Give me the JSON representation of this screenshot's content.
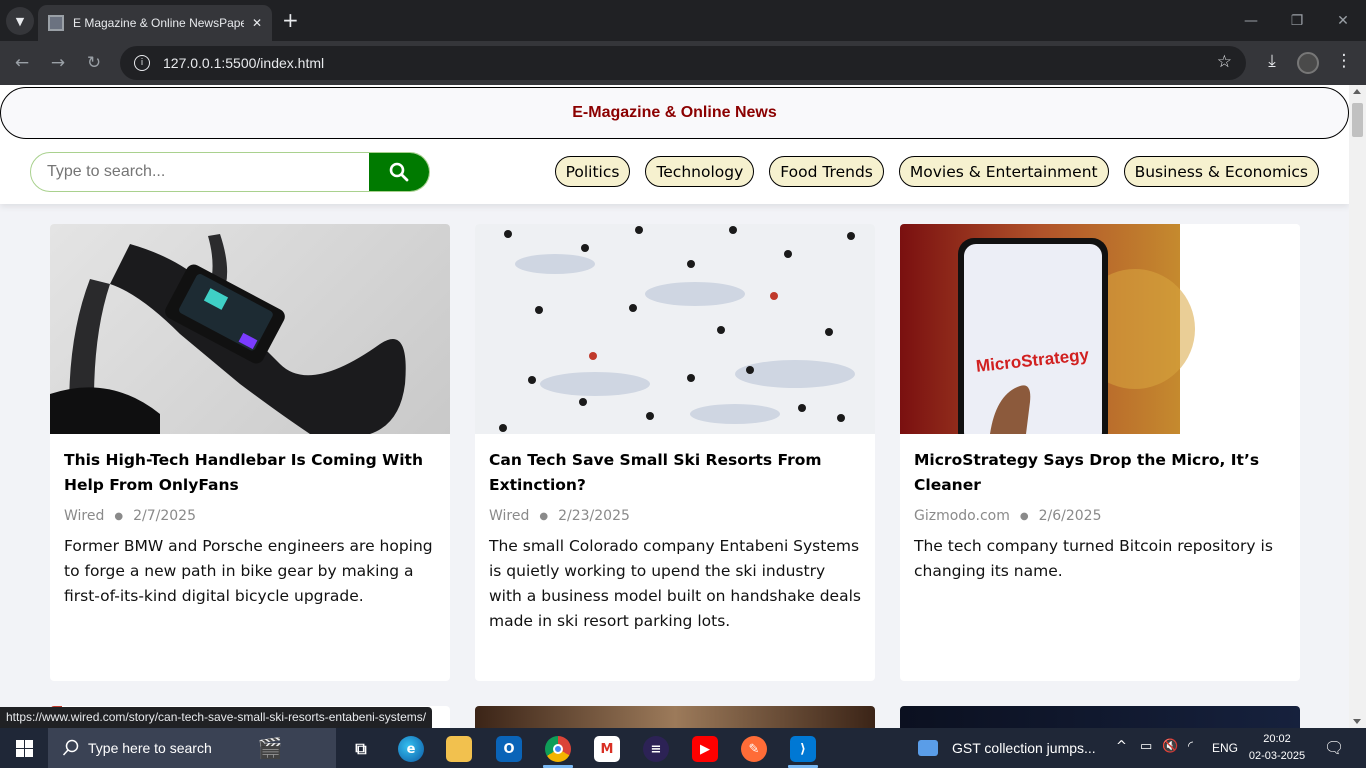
{
  "browser": {
    "tab_title": "E Magazine & Online NewsPaper",
    "url": "127.0.0.1:5500/index.html",
    "status_url": "https://www.wired.com/story/can-tech-save-small-ski-resorts-entabeni-systems/"
  },
  "site": {
    "title": "E-Magazine & Online News",
    "search_placeholder": "Type to search...",
    "categories": [
      "Politics",
      "Technology",
      "Food Trends",
      "Movies & Entertainment",
      "Business & Economics"
    ]
  },
  "articles": [
    {
      "title": "This High-Tech Handlebar Is Coming With Help From OnlyFans",
      "source": "Wired",
      "date": "2/7/2025",
      "description": "Former BMW and Porsche engineers are hoping to forge a new path in bike gear by making a first-of-its-kind digital bicycle upgrade."
    },
    {
      "title": "Can Tech Save Small Ski Resorts From Extinction?",
      "source": "Wired",
      "date": "2/23/2025",
      "description": "The small Colorado company Entabeni Systems is quietly working to upend the ski industry with a business model built on handshake deals made in ski resort parking lots."
    },
    {
      "title": "MicroStrategy Says Drop the Micro, It’s Cleaner",
      "source": "Gizmodo.com",
      "date": "2/6/2025",
      "description": "The tech company turned Bitcoin repository is changing its name.",
      "image_text": "MicroStrategy"
    }
  ],
  "taskbar": {
    "search_placeholder": "Type here to search",
    "news_ticker": "GST collection jumps...",
    "language": "ENG",
    "time": "20:02",
    "date": "02-03-2025"
  },
  "colors": {
    "site_title": "#8b0000",
    "search_button": "#007a00",
    "category_pill": "#f6f1cf",
    "taskbar": "#1f2737"
  }
}
